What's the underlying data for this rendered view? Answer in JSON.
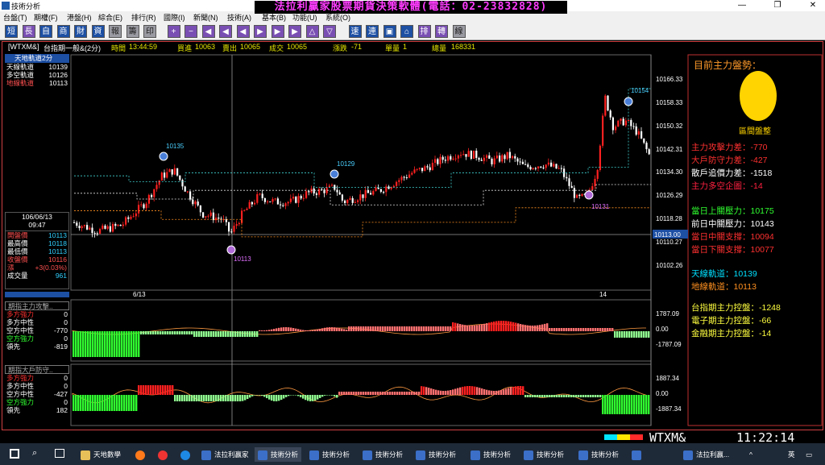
{
  "window": {
    "title": "技術分析",
    "min": "—",
    "max": "❐",
    "close": "✕"
  },
  "banner": "法拉利贏家股票期貨決策軟體(電話：02-23832828)",
  "menu": [
    "台盤(T)",
    "期權(F)",
    "港盤(H)",
    "綜合(E)",
    "排行(R)",
    "國際(I)",
    "新聞(N)",
    "技術(A)",
    "基本(B)",
    "功能(U)",
    "系統(O)"
  ],
  "toolbar": [
    "短",
    "長",
    "自",
    "商",
    "財",
    "資",
    "報",
    "籌",
    "印",
    "+",
    "−",
    "◀",
    "◀",
    "◀",
    "▶",
    "▶",
    "▶",
    "△",
    "▽",
    "速",
    "連",
    "▣",
    "⌂",
    "排",
    "轉",
    "線"
  ],
  "info": {
    "symbol": "[WTXM&]",
    "name": "台指期一般&(2分)",
    "time_label": "時間",
    "time": "13:44:59",
    "buy_label": "買進",
    "buy": "10063",
    "sell_label": "賣出",
    "sell": "10065",
    "deal_label": "成交",
    "deal": "10065",
    "chg_label": "漲跌",
    "chg": "-71",
    "vol_label": "單量",
    "vol": "1",
    "total_label": "總量",
    "total": "168331"
  },
  "orbit": {
    "title": "天地軌道2分",
    "rows": [
      {
        "label": "天線軌道",
        "value": "10139"
      },
      {
        "label": "多空軌道",
        "value": "10126"
      },
      {
        "label": "地線軌道",
        "value": "10113"
      }
    ]
  },
  "datebox": {
    "date": "106/06/13",
    "time": "09:47"
  },
  "ohlc": [
    {
      "label": "開盤價",
      "value": "10113"
    },
    {
      "label": "最高價",
      "value": "10118"
    },
    {
      "label": "最低價",
      "value": "10113"
    },
    {
      "label": "收盤價",
      "value": "10116"
    },
    {
      "label": "漲",
      "value": "+3(0.03%)"
    },
    {
      "label": "成交量",
      "value": "961"
    }
  ],
  "sub1": {
    "title": "期指主力攻擊..",
    "rows": [
      {
        "label": "多方強力",
        "value": "0"
      },
      {
        "label": "多方中性",
        "value": "0"
      },
      {
        "label": "空方中性",
        "value": "-770"
      },
      {
        "label": "空方強力",
        "value": "0"
      },
      {
        "label": "領先",
        "value": "-819"
      }
    ]
  },
  "sub2": {
    "title": "期指大戶防守..",
    "rows": [
      {
        "label": "多方強力",
        "value": "0"
      },
      {
        "label": "多方中性",
        "value": "0"
      },
      {
        "label": "空方中性",
        "value": "-427"
      },
      {
        "label": "空方強力",
        "value": "0"
      },
      {
        "label": "領先",
        "value": "182"
      }
    ]
  },
  "right": {
    "title": "目前主力盤勢：",
    "logo": "區間盤整",
    "items1": [
      {
        "label": "主力攻擊力差：",
        "value": "-770",
        "color": "#ff3030"
      },
      {
        "label": "大戶防守力差：",
        "value": "-427",
        "color": "#ff3030"
      },
      {
        "label": "散戶追價力差：",
        "value": "-1518",
        "color": "#ffffff"
      },
      {
        "label": "主力多空企圖：",
        "value": "-14",
        "color": "#ff2040"
      }
    ],
    "items2": [
      {
        "label": "當日上關壓力：",
        "value": "10175",
        "color": "#30ff30"
      },
      {
        "label": "前日中關壓力：",
        "value": "10143",
        "color": "#ffffff"
      },
      {
        "label": "當日中關支撐：",
        "value": "10094",
        "color": "#ff3030"
      },
      {
        "label": "當日下關支撐：",
        "value": "10077",
        "color": "#ff3030"
      }
    ],
    "items3": [
      {
        "label": "天線軌道：",
        "value": "10139",
        "color": "#00e0ff"
      },
      {
        "label": "地線軌道：",
        "value": "10113",
        "color": "#ff9020"
      }
    ],
    "items4": [
      {
        "label": "台指期主力控盤：",
        "value": "-1248",
        "color": "#ffff40"
      },
      {
        "label": "電子期主力控盤：",
        "value": "-66",
        "color": "#ffff40"
      },
      {
        "label": "金融期主力控盤：",
        "value": "-14",
        "color": "#ffff40"
      }
    ]
  },
  "axis": {
    "price": [
      "10166.33",
      "10158.33",
      "10150.32",
      "10142.31",
      "10134.30",
      "10126.29",
      "10118.28",
      "10110.27",
      "10102.26"
    ],
    "current": "10113.00",
    "sub1": [
      "1787.09",
      "0.00",
      "-1787.09"
    ],
    "sub2": [
      "1887.34",
      "0.00",
      "-1887.34"
    ],
    "dates": [
      "6/13",
      "14"
    ]
  },
  "annotations": {
    "high": "10135",
    "mid": "10129",
    "low": "10113",
    "peak": "10154",
    "dip": "10131"
  },
  "status": {
    "symbol": "WTXM&",
    "clock": "11:22:14"
  },
  "taskbar": [
    "天地數學",
    "法拉利贏家",
    "技術分析",
    "技術分析",
    "技術分析",
    "技術分析",
    "技術分析",
    "技術分析",
    "技術分析",
    "法拉利贏...",
    "英"
  ],
  "colors": {
    "up": "#ff2020",
    "down": "#ffffff",
    "bull_bar": "#ff6060",
    "bear_bar": "#40ff40"
  }
}
